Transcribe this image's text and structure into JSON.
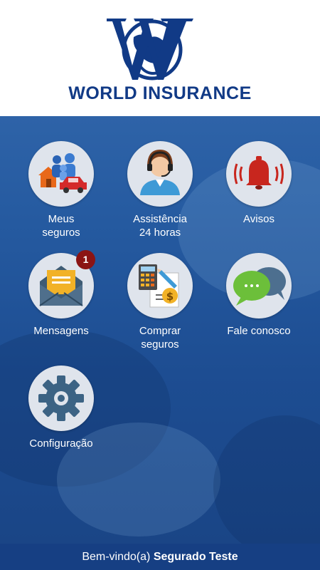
{
  "header": {
    "brand_name": "WORLD INSURANCE",
    "logo_icon": "world-insurance-logo"
  },
  "menu": {
    "items": [
      {
        "label": "Meus\nseguros",
        "icon": "family-house-car-icon"
      },
      {
        "label": "Assistência\n24 horas",
        "icon": "call-center-agent-icon"
      },
      {
        "label": "Avisos",
        "icon": "alarm-bell-icon"
      },
      {
        "label": "Mensagens",
        "icon": "envelope-icon",
        "badge": "1"
      },
      {
        "label": "Comprar\nseguros",
        "icon": "calculator-document-icon"
      },
      {
        "label": "Fale conosco",
        "icon": "chat-bubbles-icon"
      },
      {
        "label": "Configuração",
        "icon": "gear-icon"
      }
    ]
  },
  "footer": {
    "greeting": "Bem-vindo(a)",
    "user_name": "Segurado Teste"
  },
  "colors": {
    "brand": "#113a86",
    "background": "#1f4f94",
    "tile_circle": "#dfe4ec",
    "badge": "#8b1414"
  }
}
